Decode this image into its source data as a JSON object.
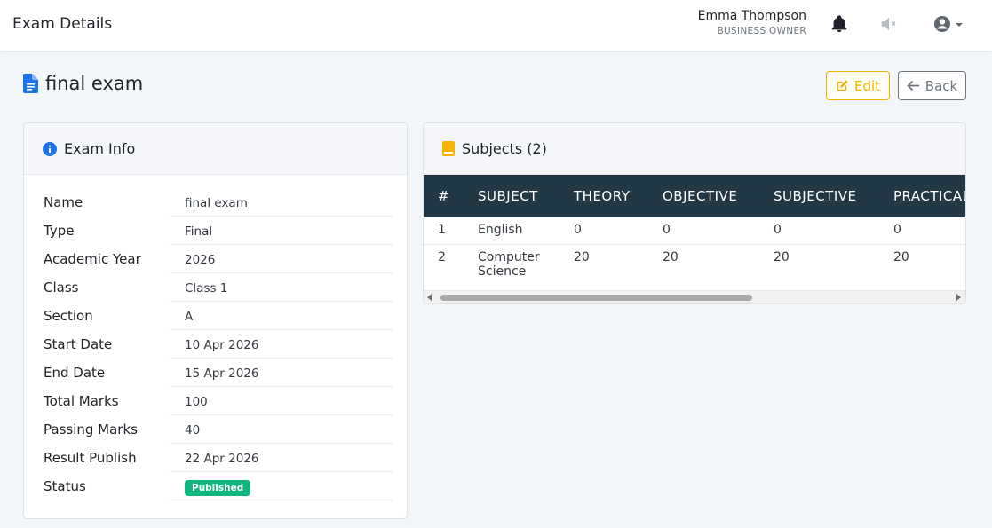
{
  "topbar": {
    "title": "Exam Details",
    "user_name": "Emma Thompson",
    "user_role": "BUSINESS OWNER",
    "icons": [
      "bell-icon",
      "mute-icon",
      "account-icon"
    ]
  },
  "page": {
    "title": "final exam",
    "edit_label": "Edit",
    "back_label": "Back"
  },
  "info_card": {
    "title": "Exam Info",
    "rows": [
      {
        "label": "Name",
        "value": "final exam"
      },
      {
        "label": "Type",
        "value": "Final"
      },
      {
        "label": "Academic Year",
        "value": "2026"
      },
      {
        "label": "Class",
        "value": "Class 1"
      },
      {
        "label": "Section",
        "value": "A"
      },
      {
        "label": "Start Date",
        "value": "10 Apr 2026"
      },
      {
        "label": "End Date",
        "value": "15 Apr 2026"
      },
      {
        "label": "Total Marks",
        "value": "100"
      },
      {
        "label": "Passing Marks",
        "value": "40"
      },
      {
        "label": "Result Publish",
        "value": "22 Apr 2026"
      },
      {
        "label": "Status",
        "value": "Published"
      }
    ]
  },
  "subjects_card": {
    "title": "Subjects (2)",
    "columns": [
      "#",
      "SUBJECT",
      "THEORY",
      "OBJECTIVE",
      "SUBJECTIVE",
      "PRACTICAL"
    ],
    "rows": [
      [
        "1",
        "English",
        "0",
        "0",
        "0",
        "0"
      ],
      [
        "2",
        "Computer Science",
        "20",
        "20",
        "20",
        "20"
      ]
    ]
  },
  "colors": {
    "header_bg": "#233845",
    "edit": "#f0b400",
    "published": "#0eb67e",
    "primary": "#1a73e8"
  }
}
